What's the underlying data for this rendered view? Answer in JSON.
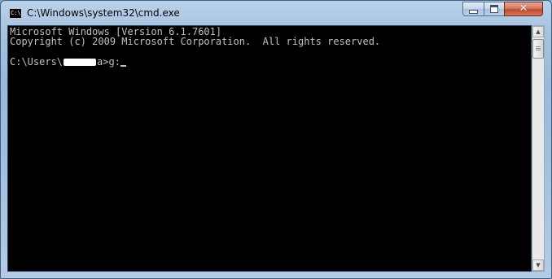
{
  "window": {
    "title": "C:\\Windows\\system32\\cmd.exe",
    "app_icon": "cmd-icon",
    "app_icon_text": "C:\\",
    "controls": {
      "minimize_icon": "minimize-icon",
      "maximize_icon": "maximize-icon",
      "close_icon": "close-icon",
      "close_glyph": "✕"
    }
  },
  "console": {
    "line1": "Microsoft Windows [Version 6.1.7601]",
    "line2": "Copyright (c) 2009 Microsoft Corporation.  All rights reserved.",
    "prompt_prefix": "C:\\Users\\",
    "prompt_suffix": "a>g:",
    "text_color": "#c0c0c0",
    "background_color": "#000000"
  },
  "scrollbar": {
    "up_glyph": "▲",
    "down_glyph": "▼"
  }
}
